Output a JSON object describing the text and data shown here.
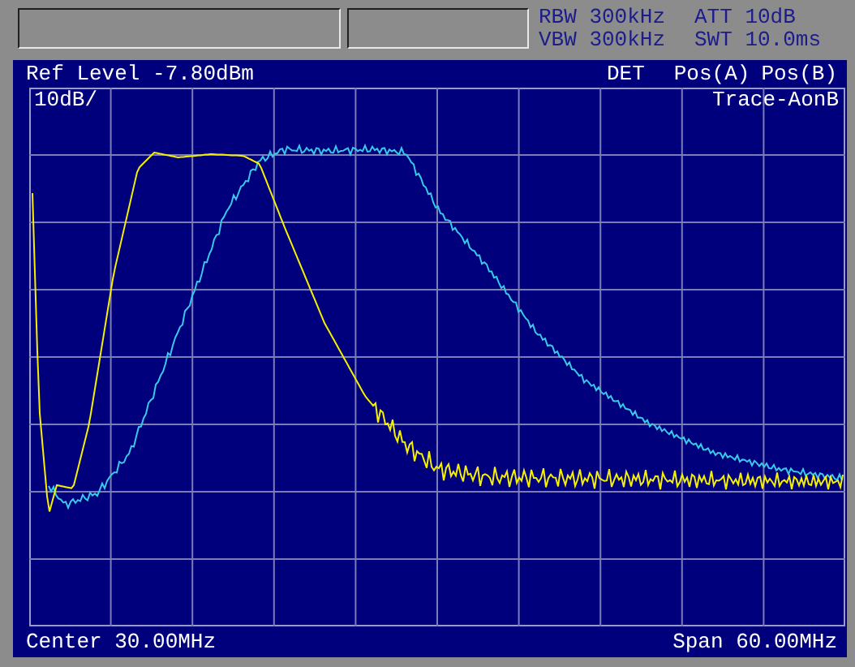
{
  "status": {
    "rbw": "RBW 300kHz",
    "att": "ATT 10dB",
    "vbw": "VBW 300kHz",
    "swt": "SWT 10.0ms"
  },
  "header": {
    "ref_level": "Ref Level -7.80dBm",
    "det": "DET",
    "pos_a": "Pos(A)",
    "pos_b": "Pos(B)"
  },
  "graph": {
    "scale": "10dB/",
    "trace_mode": "Trace-AonB"
  },
  "footer": {
    "center": "Center 30.00MHz",
    "span": "Span 60.00MHz"
  }
}
